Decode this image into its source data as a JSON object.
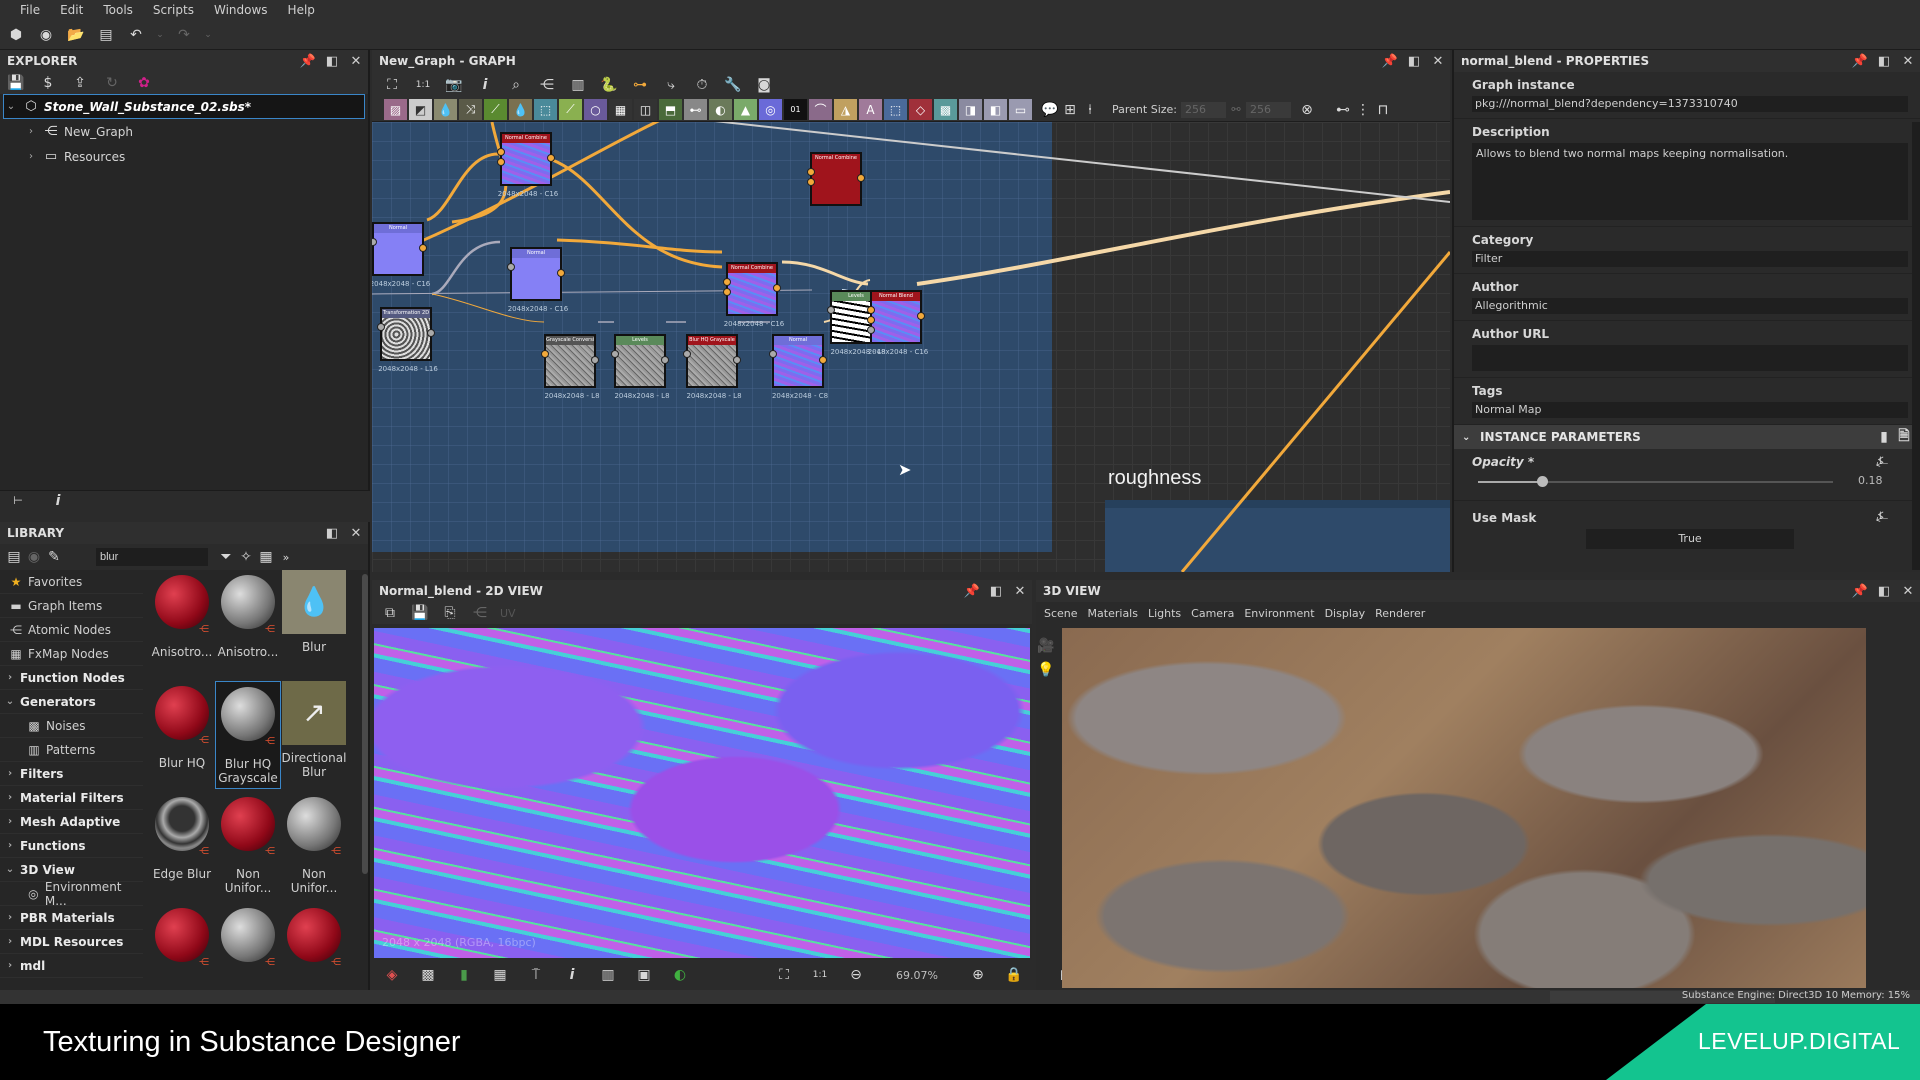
{
  "menu": [
    "File",
    "Edit",
    "Tools",
    "Scripts",
    "Windows",
    "Help"
  ],
  "explorer": {
    "title": "EXPLORER",
    "package": "Stone_Wall_Substance_02.sbs*",
    "items": [
      {
        "label": "New_Graph",
        "icon": "graph-icon"
      },
      {
        "label": "Resources",
        "icon": "folder-icon"
      }
    ]
  },
  "library": {
    "title": "LIBRARY",
    "search_value": "blur",
    "categories": [
      {
        "label": "Favorites",
        "icon": "star-icon",
        "bold": false,
        "chevron": ""
      },
      {
        "label": "Graph Items",
        "icon": "comment-icon",
        "bold": false,
        "chevron": ""
      },
      {
        "label": "Atomic Nodes",
        "icon": "atomic-icon",
        "bold": false,
        "chevron": ""
      },
      {
        "label": "FxMap Nodes",
        "icon": "fxmap-icon",
        "bold": false,
        "chevron": ""
      },
      {
        "label": "Function Nodes",
        "icon": "",
        "bold": true,
        "chevron": "›"
      },
      {
        "label": "Generators",
        "icon": "",
        "bold": true,
        "chevron": "⌄"
      },
      {
        "label": "Noises",
        "icon": "noise-icon",
        "bold": false,
        "chevron": "",
        "sub": true
      },
      {
        "label": "Patterns",
        "icon": "pattern-icon",
        "bold": false,
        "chevron": "",
        "sub": true
      },
      {
        "label": "Filters",
        "icon": "",
        "bold": true,
        "chevron": "›"
      },
      {
        "label": "Material Filters",
        "icon": "",
        "bold": true,
        "chevron": "›"
      },
      {
        "label": "Mesh Adaptive",
        "icon": "",
        "bold": true,
        "chevron": "›"
      },
      {
        "label": "Functions",
        "icon": "",
        "bold": true,
        "chevron": "›"
      },
      {
        "label": "3D View",
        "icon": "",
        "bold": true,
        "chevron": "⌄"
      },
      {
        "label": "Environment M...",
        "icon": "globe-icon",
        "bold": false,
        "chevron": "",
        "sub": true
      },
      {
        "label": "PBR Materials",
        "icon": "",
        "bold": true,
        "chevron": "›"
      },
      {
        "label": "MDL Resources",
        "icon": "",
        "bold": true,
        "chevron": "›"
      },
      {
        "label": "mdl",
        "icon": "",
        "bold": true,
        "chevron": "›"
      }
    ],
    "tiles": [
      {
        "label": "Anisotro...",
        "kind": "red"
      },
      {
        "label": "Anisotro...",
        "kind": "grey"
      },
      {
        "label": "Blur",
        "kind": "drop"
      },
      {
        "label": "Blur HQ",
        "kind": "red"
      },
      {
        "label": "Blur HQ Grayscale",
        "kind": "grey",
        "selected": true
      },
      {
        "label": "Directional Blur",
        "kind": "dirdrop"
      },
      {
        "label": "Edge Blur",
        "kind": "glass"
      },
      {
        "label": "Non Unifor...",
        "kind": "red"
      },
      {
        "label": "Non Unifor...",
        "kind": "grey"
      },
      {
        "label": "",
        "kind": "red"
      },
      {
        "label": "",
        "kind": "grey"
      },
      {
        "label": "",
        "kind": "red"
      }
    ]
  },
  "graph": {
    "title": "New_Graph - GRAPH",
    "parent_size_label": "Parent Size:",
    "parent_size_w": "256",
    "parent_size_h": "256",
    "frame_label": "roughness",
    "nodes": [
      {
        "title": "Normal Combine",
        "res": "2048x2048 - C16",
        "header": "#a0141c",
        "tex": "normal"
      },
      {
        "title": "Normal Combine",
        "res": "",
        "header": "#a0141c",
        "tex": "red"
      },
      {
        "title": "Normal",
        "res": "2048x2048 - C16",
        "header": "#6f6ed8",
        "tex": "flat"
      },
      {
        "title": "Normal",
        "res": "2048x2048 - C16",
        "header": "#6f6ed8",
        "tex": "flat"
      },
      {
        "title": "Normal Combine",
        "res": "2048x2048 - C16",
        "header": "#a0141c",
        "tex": "normal"
      },
      {
        "title": "Transformation 2D",
        "res": "2048x2048 - L16",
        "header": "#555a80",
        "tex": "noise"
      },
      {
        "title": "Levels",
        "res": "2048x2048 - L8",
        "header": "#5a8a5a",
        "tex": "levels"
      },
      {
        "title": "Grayscale Conversion",
        "res": "2048x2048 - L8",
        "header": "#555555",
        "tex": "grey"
      },
      {
        "title": "Levels",
        "res": "2048x2048 - L8",
        "header": "#5a8a5a",
        "tex": "grey"
      },
      {
        "title": "Blur HQ Grayscale",
        "res": "2048x2048 - L8",
        "header": "#a0141c",
        "tex": "grey"
      },
      {
        "title": "Normal",
        "res": "2048x2048 - C8",
        "header": "#6f6ed8",
        "tex": "normal"
      },
      {
        "title": "Normal Blend",
        "res": "2048x2048 - C16",
        "header": "#a0141c",
        "tex": "normal"
      }
    ]
  },
  "properties": {
    "title": "normal_blend - PROPERTIES",
    "fields": [
      {
        "label": "Graph instance",
        "value": "pkg:///normal_blend?dependency=1373310740"
      },
      {
        "label": "Description",
        "value": "Allows to blend two normal maps keeping normalisation."
      },
      {
        "label": "Category",
        "value": "Filter"
      },
      {
        "label": "Author",
        "value": "Allegorithmic"
      },
      {
        "label": "Author URL",
        "value": ""
      },
      {
        "label": "Tags",
        "value": "Normal Map"
      }
    ],
    "instance_params_title": "INSTANCE PARAMETERS",
    "opacity_label": "Opacity *",
    "opacity_value": "0.18",
    "opacity_fraction": 0.18,
    "use_mask_label": "Use Mask",
    "use_mask_value": "True"
  },
  "view2d": {
    "title": "Normal_blend - 2D VIEW",
    "uv_label": "UV",
    "info": "2048 x 2048 (RGBA, 16bpc)",
    "zoom": "69.07%"
  },
  "view3d": {
    "title": "3D VIEW",
    "menu": [
      "Scene",
      "Materials",
      "Lights",
      "Camera",
      "Environment",
      "Display",
      "Renderer"
    ]
  },
  "status": {
    "text": "Substance Engine: Direct3D 10  Memory: 15%"
  },
  "banner": {
    "title": "Texturing in Substance Designer",
    "brand": "LEVELUP.DIGITAL",
    "brand_color": "#13c48f"
  }
}
